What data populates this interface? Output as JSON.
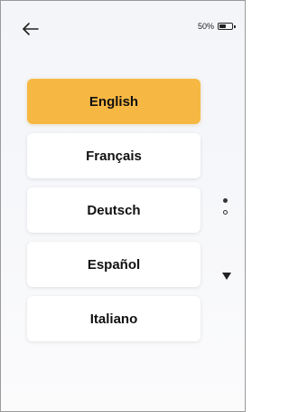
{
  "header": {
    "back_icon": "arrow-left-icon",
    "battery_text": "50%",
    "battery_level": 0.5
  },
  "languages": [
    {
      "label": "English",
      "selected": true
    },
    {
      "label": "Français",
      "selected": false
    },
    {
      "label": "Deutsch",
      "selected": false
    },
    {
      "label": "Español",
      "selected": false
    },
    {
      "label": "Italiano",
      "selected": false
    }
  ],
  "pagination": {
    "pages": 2,
    "current": 1
  },
  "colors": {
    "selected_bg": "#f7b843",
    "item_bg": "#ffffff",
    "text": "#111111"
  }
}
